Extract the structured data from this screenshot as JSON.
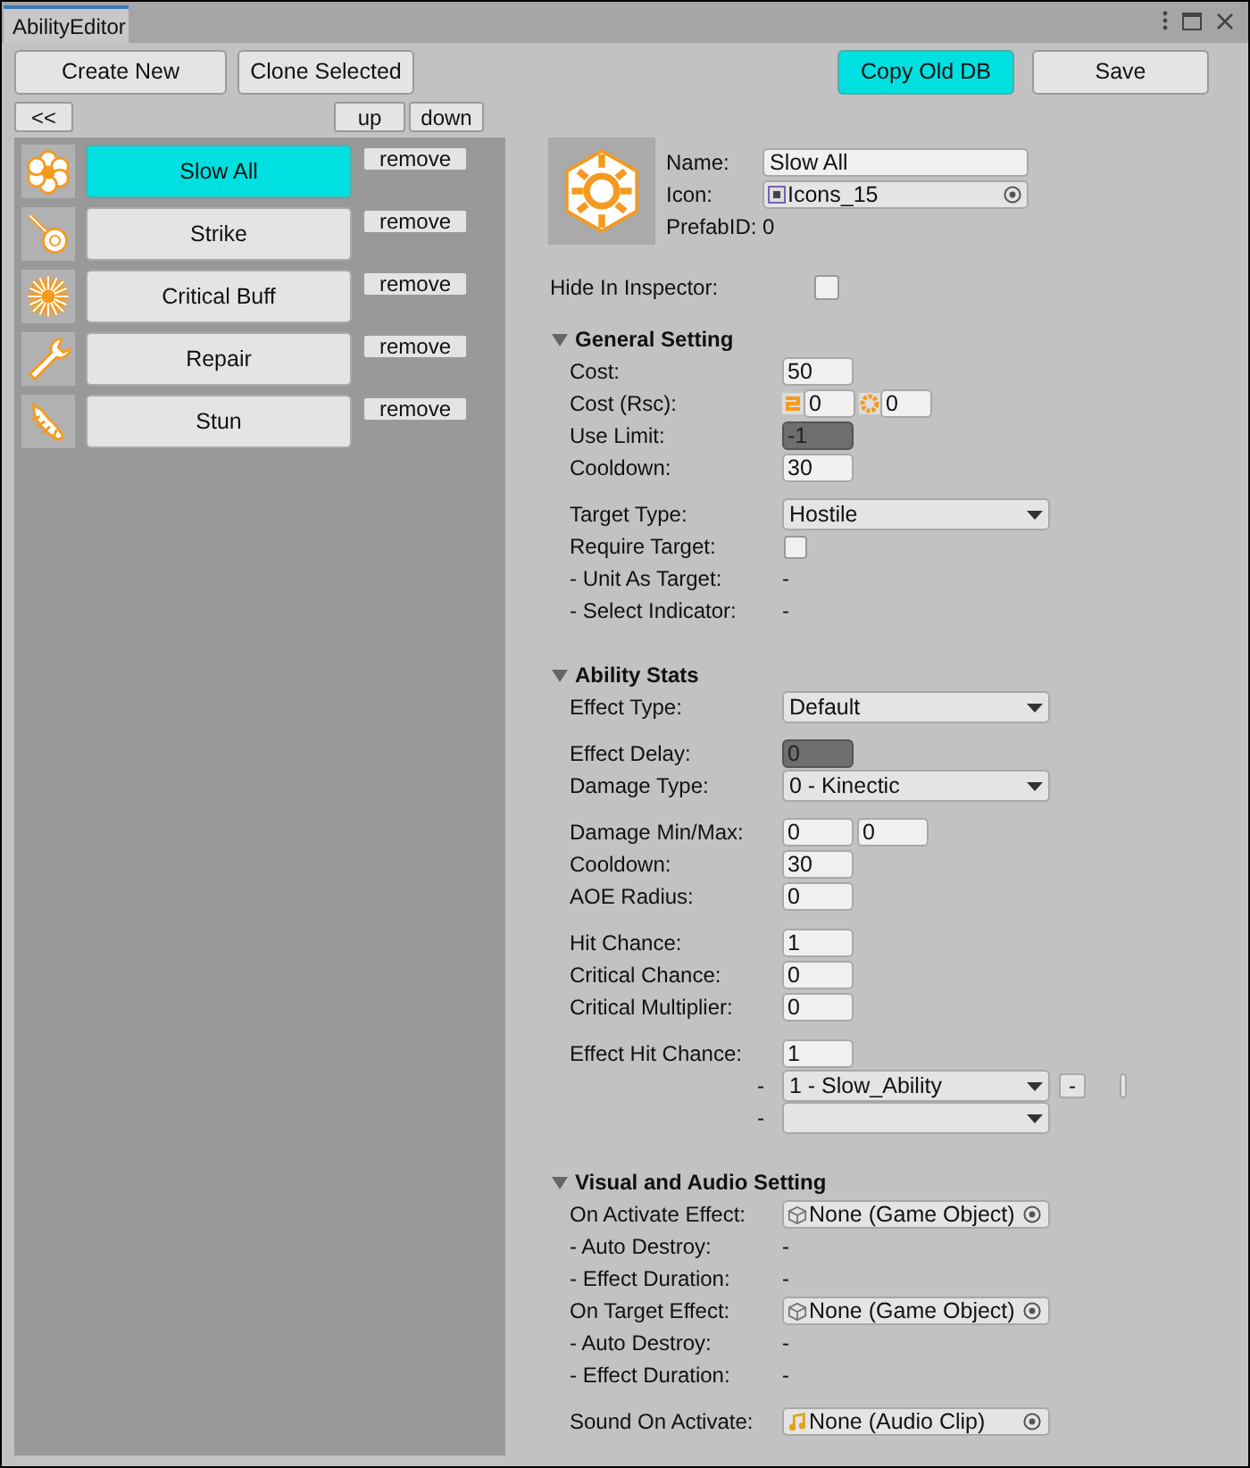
{
  "window": {
    "tab": "AbilityEditor"
  },
  "toolbar": {
    "left_buttons": [
      "Create New",
      "Clone Selected"
    ],
    "right_buttons": [
      {
        "label": "Copy Old DB",
        "highlighted": true
      },
      {
        "label": "Save",
        "highlighted": false
      }
    ]
  },
  "list_controls": {
    "collapse": "<<",
    "up": "up",
    "down": "down"
  },
  "abilities": [
    {
      "name": "Slow All",
      "selected": true,
      "remove": "remove"
    },
    {
      "name": "Strike",
      "selected": false,
      "remove": "remove"
    },
    {
      "name": "Critical Buff",
      "selected": false,
      "remove": "remove"
    },
    {
      "name": "Repair",
      "selected": false,
      "remove": "remove"
    },
    {
      "name": "Stun",
      "selected": false,
      "remove": "remove"
    }
  ],
  "detail": {
    "name_label": "Name:",
    "name_value": "Slow All",
    "icon_label": "Icon:",
    "icon_value": "Icons_15",
    "prefab_id": "PrefabID: 0",
    "hide_label": "Hide In Inspector:",
    "hide_checked": false
  },
  "sections": [
    {
      "title": "General Setting",
      "expanded": true,
      "groups": [
        [
          {
            "kind": "number",
            "label": "Cost:",
            "value": "50"
          },
          {
            "kind": "resource",
            "label": "Cost (Rsc):",
            "values": [
              "0",
              "0"
            ]
          },
          {
            "kind": "number",
            "label": "Use Limit:",
            "value": "-1",
            "disabled": true
          },
          {
            "kind": "number",
            "label": "Cooldown:",
            "value": "30"
          }
        ],
        [
          {
            "kind": "dropdown",
            "label": "Target Type:",
            "value": "Hostile"
          },
          {
            "kind": "checkbox",
            "label": "Require Target:",
            "checked": false
          },
          {
            "kind": "dash",
            "label": "- Unit As Target:",
            "value": "-"
          },
          {
            "kind": "dash",
            "label": "- Select Indicator:",
            "value": "-"
          }
        ]
      ]
    },
    {
      "title": "Ability Stats",
      "expanded": true,
      "groups": [
        [
          {
            "kind": "dropdown",
            "label": "Effect Type:",
            "value": "Default"
          }
        ],
        [
          {
            "kind": "number",
            "label": "Effect Delay:",
            "value": "0",
            "disabled": true
          },
          {
            "kind": "dropdown",
            "label": "Damage Type:",
            "value": "0 - Kinectic"
          }
        ],
        [
          {
            "kind": "pair",
            "label": "Damage Min/Max:",
            "values": [
              "0",
              "0"
            ]
          },
          {
            "kind": "number",
            "label": "Cooldown:",
            "value": "30"
          },
          {
            "kind": "number",
            "label": "AOE Radius:",
            "value": "0"
          }
        ],
        [
          {
            "kind": "number",
            "label": "Hit Chance:",
            "value": "1"
          },
          {
            "kind": "number",
            "label": "Critical Chance:",
            "value": "0"
          },
          {
            "kind": "number",
            "label": "Critical Multiplier:",
            "value": "0"
          }
        ],
        [
          {
            "kind": "number",
            "label": "Effect Hit Chance:",
            "value": "1"
          },
          {
            "kind": "list_item",
            "marker": "-",
            "value": "1 - Slow_Ability",
            "remove": "-"
          },
          {
            "kind": "list_item",
            "marker": "-"
          }
        ]
      ]
    },
    {
      "title": "Visual and Audio Setting",
      "expanded": true,
      "groups": [
        [
          {
            "kind": "object",
            "label": "On Activate Effect:",
            "value": "None (Game Object)"
          },
          {
            "kind": "dash",
            "label": "- Auto Destroy:",
            "value": "-"
          },
          {
            "kind": "dash",
            "label": "- Effect Duration:",
            "value": "-"
          },
          {
            "kind": "object",
            "label": "On Target Effect:",
            "value": "None (Game Object)"
          },
          {
            "kind": "dash",
            "label": "- Auto Destroy:",
            "value": "-"
          },
          {
            "kind": "dash",
            "label": "- Effect Duration:",
            "value": "-"
          }
        ],
        [
          {
            "kind": "audio",
            "label": "Sound On Activate:",
            "value": "None (Audio Clip)"
          }
        ]
      ]
    }
  ]
}
